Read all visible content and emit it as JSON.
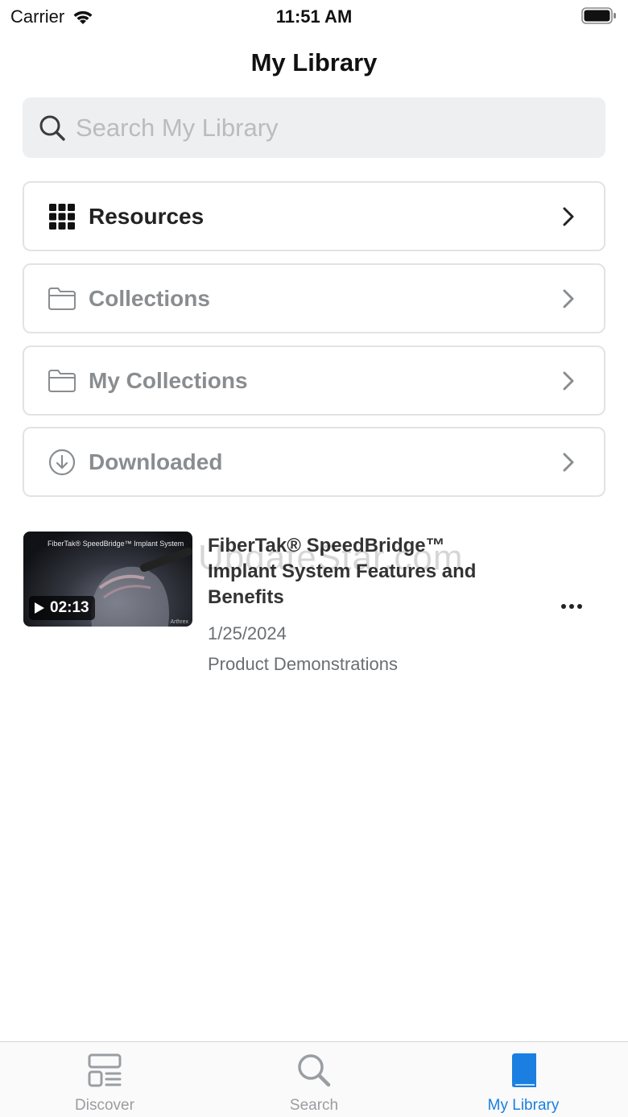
{
  "status_bar": {
    "carrier": "Carrier",
    "time": "11:51 AM"
  },
  "page": {
    "title": "My Library"
  },
  "search": {
    "placeholder": "Search My Library"
  },
  "menu": [
    {
      "label": "Resources",
      "icon": "grid-icon",
      "state": "active"
    },
    {
      "label": "Collections",
      "icon": "folder-icon",
      "state": "muted"
    },
    {
      "label": "My Collections",
      "icon": "folder-icon",
      "state": "muted"
    },
    {
      "label": "Downloaded",
      "icon": "download-circle-icon",
      "state": "muted"
    }
  ],
  "item": {
    "thumbnail_caption": "FiberTak® SpeedBridge™ Implant System",
    "thumbnail_logo": "Arthrex",
    "duration": "02:13",
    "title": "FiberTak® SpeedBridge™ Implant System Features and Benefits",
    "date": "1/25/2024",
    "category": "Product Demonstrations"
  },
  "watermark": "UpdateStar.com",
  "tabs": [
    {
      "label": "Discover",
      "icon": "discover-icon",
      "active": false
    },
    {
      "label": "Search",
      "icon": "magnifier-icon",
      "active": false
    },
    {
      "label": "My Library",
      "icon": "book-icon",
      "active": true
    }
  ],
  "colors": {
    "accent": "#1a7fe0",
    "muted": "#8a8d90",
    "search_bg": "#eeeff0"
  }
}
